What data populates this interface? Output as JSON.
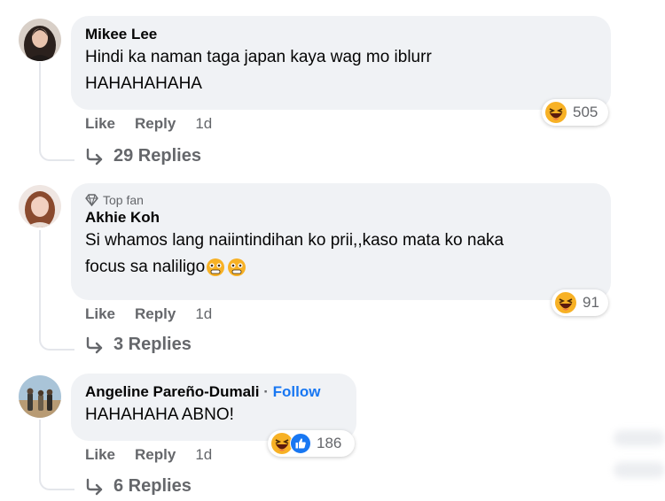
{
  "comments": [
    {
      "author": "Mikee Lee",
      "text_lines": [
        "Hindi ka naman taga japan kaya wag mo iblurr",
        "HAHAHAHAHA"
      ],
      "like_label": "Like",
      "reply_label": "Reply",
      "time": "1d",
      "reaction_count": "505",
      "replies_label": "29 Replies"
    },
    {
      "badge": "Top fan",
      "author": "Akhie Koh",
      "text_lines": [
        "Si whamos lang naiintindihan ko prii,,kaso mata ko naka",
        "focus sa naliligo"
      ],
      "like_label": "Like",
      "reply_label": "Reply",
      "time": "1d",
      "reaction_count": "91",
      "replies_label": "3 Replies"
    },
    {
      "author": "Angeline Pareño-Dumali",
      "separator": "·",
      "follow_label": "Follow",
      "text": "HAHAHAHA ABNO!",
      "like_label": "Like",
      "reply_label": "Reply",
      "time": "1d",
      "reaction_count": "186",
      "replies_label": "6 Replies"
    }
  ],
  "icons": {
    "reaction_haha": "haha-emoji-icon",
    "reaction_like": "like-reaction-icon",
    "reply_arrow": "reply-arrow-icon",
    "top_fan": "diamond-icon",
    "flushed": "flushed-face-emoji-icon"
  },
  "colors": {
    "bubble": "#f0f2f5",
    "link_blue": "#1877f2",
    "secondary_text": "#65676b",
    "haha_yellow": "#f7b125"
  }
}
